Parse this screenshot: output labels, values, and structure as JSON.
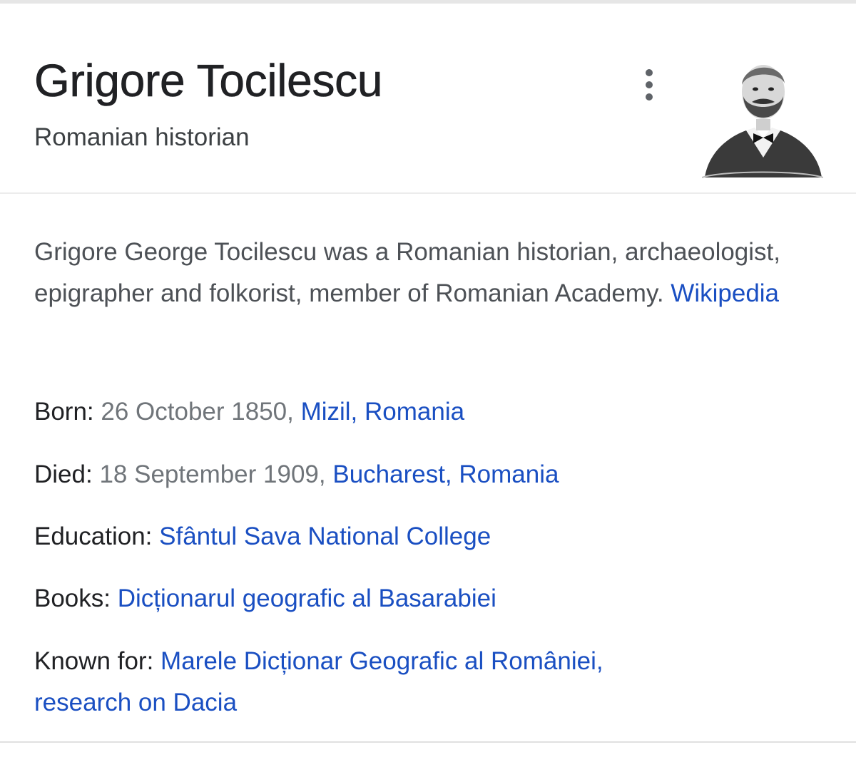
{
  "header": {
    "title": "Grigore Tocilescu",
    "subtitle": "Romanian historian"
  },
  "icons": {
    "more": "more-vert-icon"
  },
  "description": {
    "text": "Grigore George Tocilescu was a Romanian historian, archaeologist, epigrapher and folkorist, member of Romanian Academy. ",
    "source_link": "Wikipedia"
  },
  "facts": {
    "born": {
      "label": "Born:",
      "date": " 26 October 1850, ",
      "place": "Mizil, Romania"
    },
    "died": {
      "label": "Died:",
      "date": " 18 September 1909, ",
      "place": "Bucharest, Romania"
    },
    "education": {
      "label": "Education:",
      "value": "Sfântul Sava National College"
    },
    "books": {
      "label": "Books:",
      "value": "Dicționarul geografic al Basarabiei"
    },
    "known_for": {
      "label": "Known for:",
      "value1": "Marele Dicționar Geografic al României",
      "separator": ",",
      "value2": "research on Dacia"
    }
  },
  "colors": {
    "link": "#1a4fc2",
    "title": "#202124",
    "text": "#4d5156",
    "muted": "#70757a"
  }
}
